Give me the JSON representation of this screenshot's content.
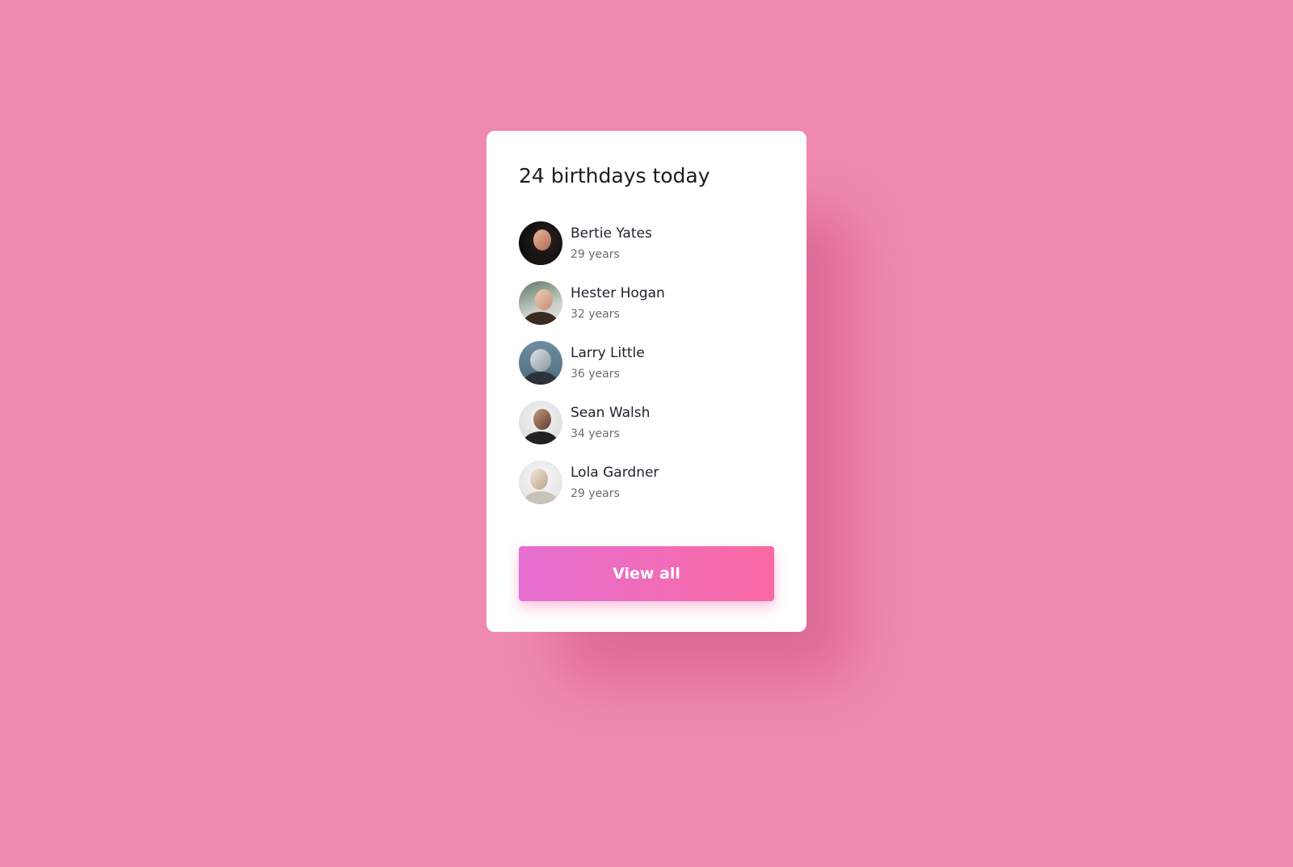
{
  "card": {
    "title": "24 birthdays today",
    "people": [
      {
        "name": "Bertie Yates",
        "age": "29 years",
        "avatar": "avatar-woman-dark-background"
      },
      {
        "name": "Hester Hogan",
        "age": "32 years",
        "avatar": "avatar-woman-eyes-closed"
      },
      {
        "name": "Larry Little",
        "age": "36 years",
        "avatar": "avatar-person-helmet"
      },
      {
        "name": "Sean Walsh",
        "age": "34 years",
        "avatar": "avatar-bearded-man"
      },
      {
        "name": "Lola Gardner",
        "age": "29 years",
        "avatar": "avatar-woman-headphones"
      }
    ],
    "button_label": "View all"
  },
  "colors": {
    "background": "#ef89b0",
    "card": "#ffffff",
    "button_gradient_start": "#e56fd2",
    "button_gradient_end": "#fb69a3"
  }
}
